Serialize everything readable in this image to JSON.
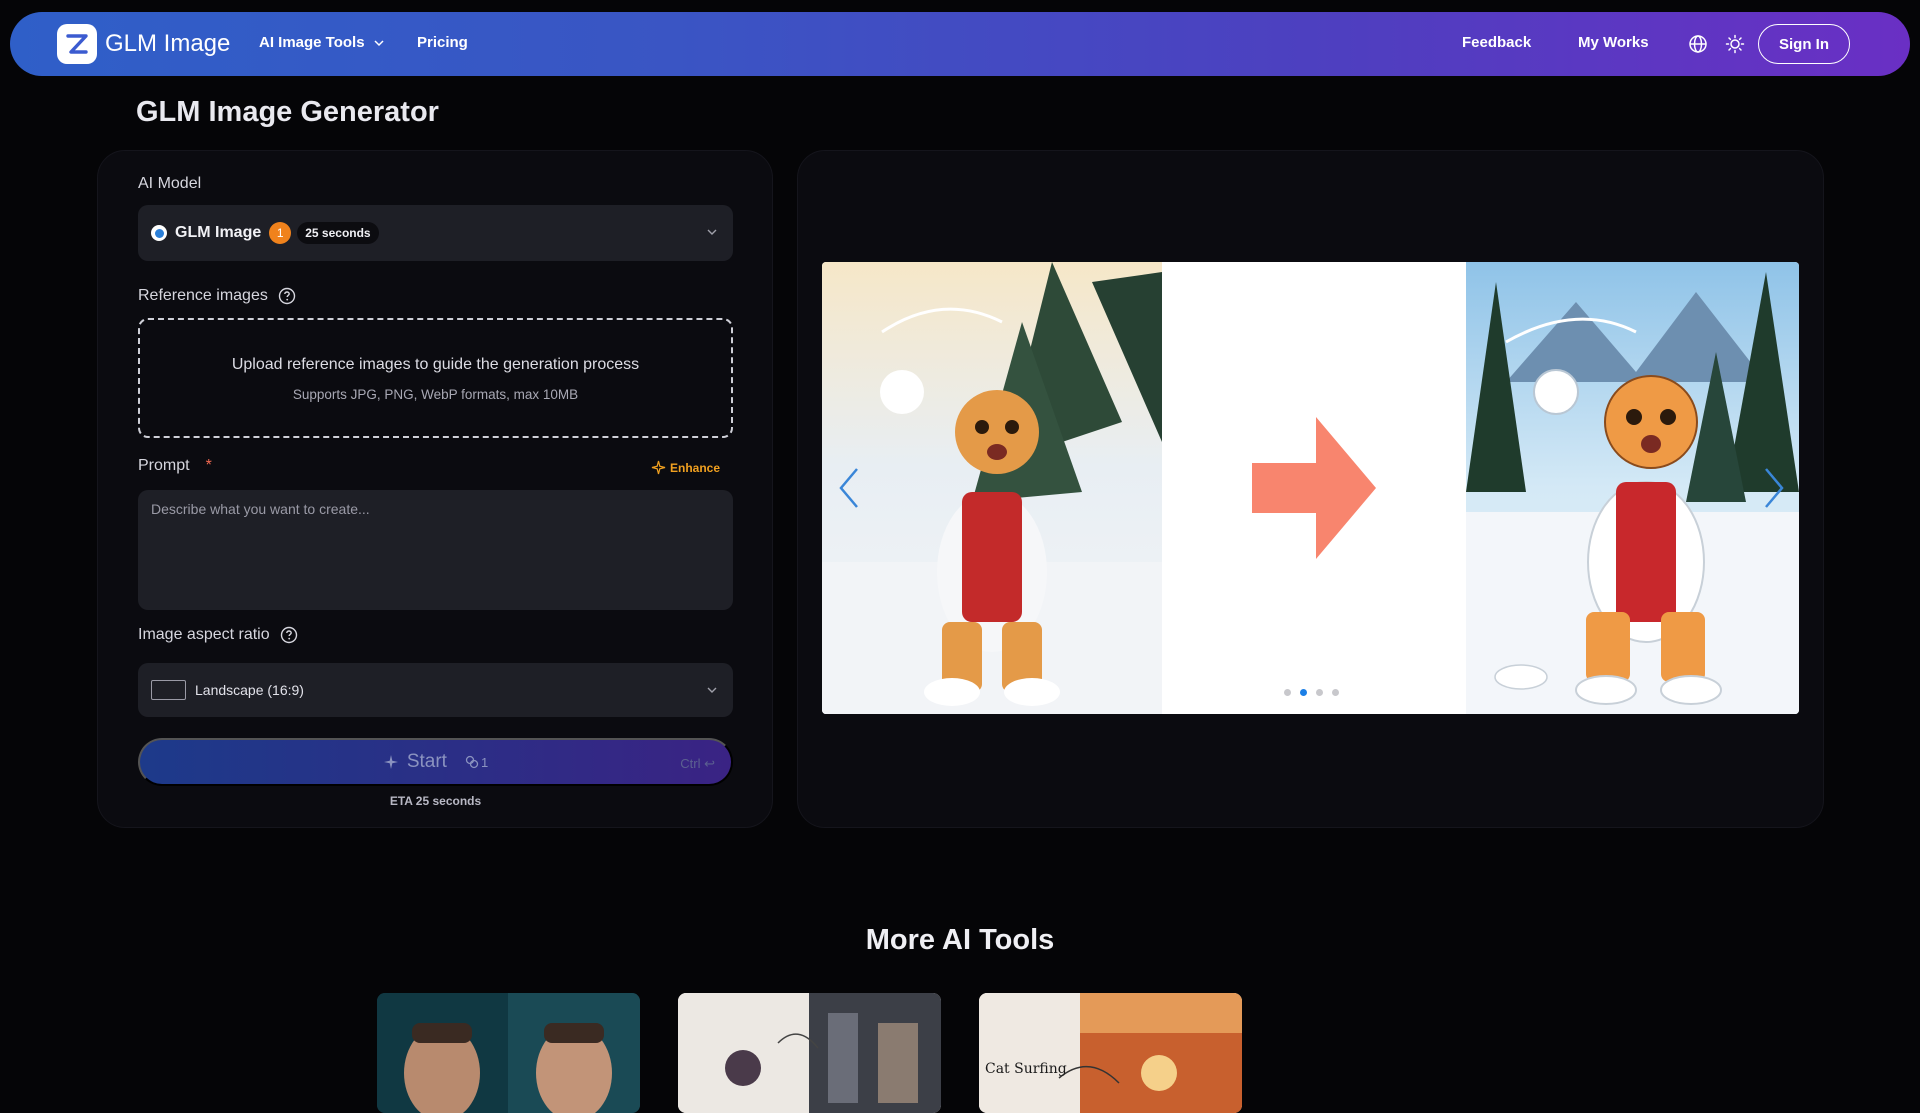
{
  "header": {
    "brand": "GLM Image",
    "nav": {
      "tools_label": "AI Image Tools",
      "pricing_label": "Pricing",
      "feedback_label": "Feedback",
      "works_label": "My Works"
    },
    "signin_label": "Sign In",
    "icons": [
      "logo-z-icon",
      "chevron-down-icon",
      "globe-icon",
      "sun-icon"
    ],
    "gradient_colors": [
      "#2f5fc8",
      "#6a2fc4"
    ]
  },
  "page_title": "GLM Image Generator",
  "form": {
    "model": {
      "label": "AI Model",
      "name": "GLM Image",
      "credits": "1",
      "time": "25 seconds"
    },
    "reference": {
      "label": "Reference images",
      "upload_text": "Upload reference images to guide the generation process",
      "upload_hint": "Supports JPG, PNG, WebP formats, max 10MB"
    },
    "prompt": {
      "label": "Prompt",
      "required_mark": "*",
      "enhance_label": "Enhance",
      "placeholder": "Describe what you want to create...",
      "value": ""
    },
    "aspect": {
      "label": "Image aspect ratio",
      "value": "Landscape (16:9)"
    },
    "start": {
      "label": "Start",
      "cost": "1",
      "shortcut": "Ctrl ↩",
      "eta": "ETA 25 seconds"
    }
  },
  "carousel": {
    "slide_count": 4,
    "active_index": 1,
    "arrow_color": "#f8856e"
  },
  "more_tools": {
    "title": "More AI Tools",
    "cards": [
      {
        "name": "face-swap-card"
      },
      {
        "name": "anime-figure-card"
      },
      {
        "name": "cat-surfing-card",
        "label": "Cat Surfing"
      }
    ]
  },
  "colors": {
    "accent_orange": "#f0821c",
    "accent_blue": "#1c7fe6",
    "enhance": "#f0a020"
  }
}
